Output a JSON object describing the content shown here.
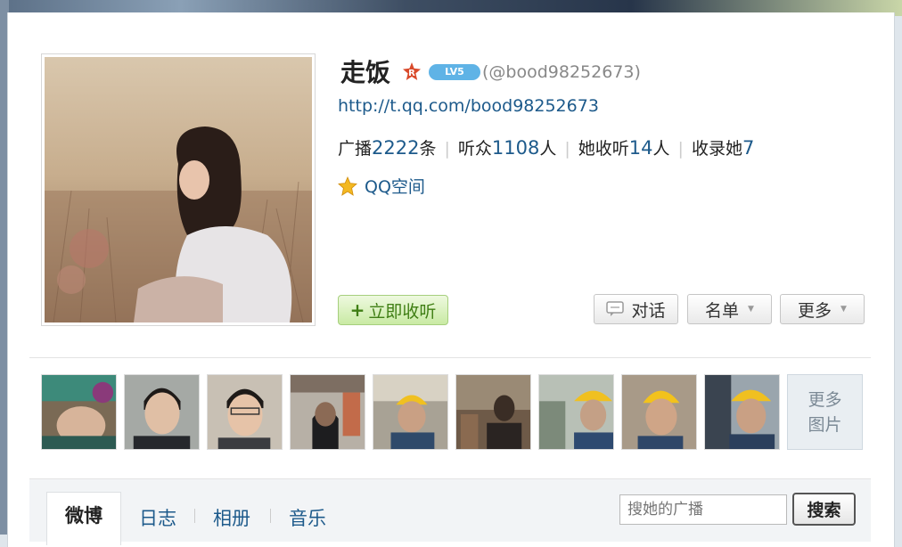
{
  "profile": {
    "name": "走饭",
    "badge_r": "R",
    "level": "LV5",
    "handle": "(@bood98252673)",
    "url": "http://t.qq.com/bood98252673",
    "qzone_label": "QQ空间"
  },
  "stats": {
    "broadcast_label": "广播",
    "broadcast_count": "2222",
    "broadcast_unit": "条",
    "listeners_label": "听众",
    "listeners_count": "1108",
    "listeners_unit": "人",
    "following_label": "她收听",
    "following_count": "14",
    "following_unit": "人",
    "collected_label": "收录她",
    "collected_count": "7"
  },
  "actions": {
    "follow_label": "立即收听",
    "talk_label": "对话",
    "list_label": "名单",
    "more_label": "更多"
  },
  "photos": {
    "more_line1": "更多",
    "more_line2": "图片"
  },
  "tabs": {
    "weibo": "微博",
    "diary": "日志",
    "album": "相册",
    "music": "音乐"
  },
  "search": {
    "placeholder": "搜她的广播",
    "button_label": "搜索"
  },
  "colors": {
    "link": "#1d5a8b",
    "follow_green": "#3f7e14",
    "level_badge": "#5fb3e6",
    "r_badge": "#d94a2b"
  }
}
